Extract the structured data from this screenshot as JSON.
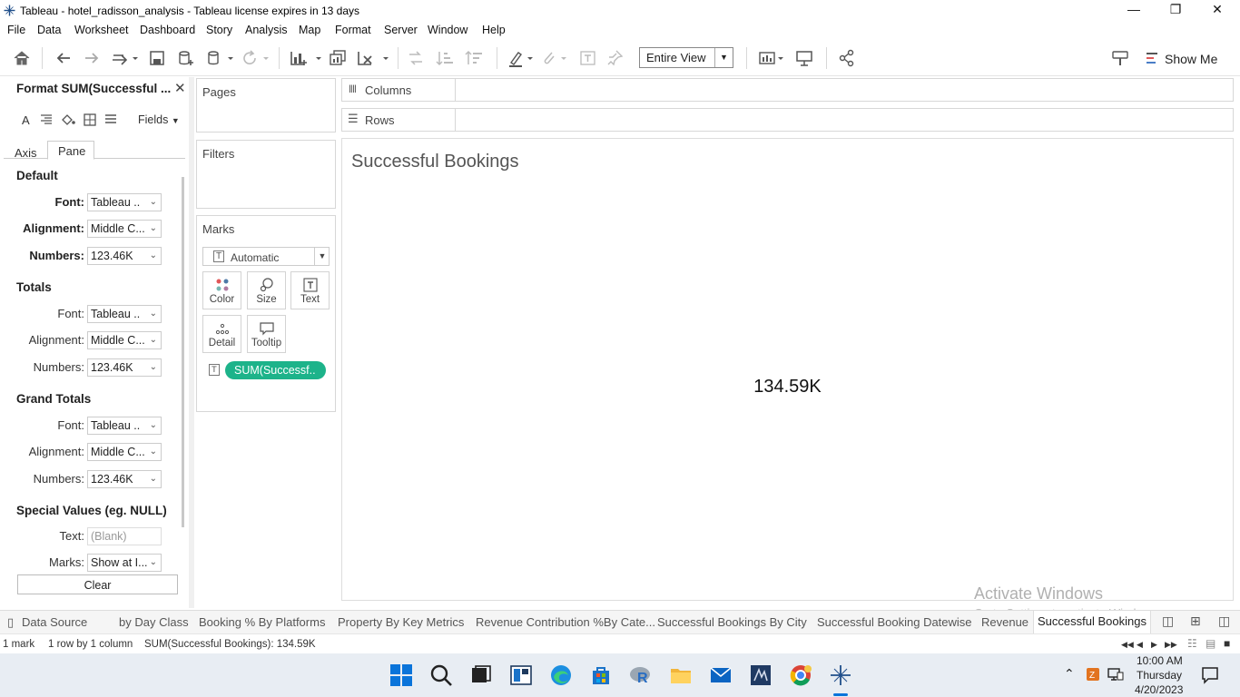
{
  "window": {
    "title": "Tableau - hotel_radisson_analysis - Tableau license expires in 13 days",
    "minimize": "—",
    "restore": "❐",
    "close": "✕"
  },
  "menu": [
    "File",
    "Data",
    "Worksheet",
    "Dashboard",
    "Story",
    "Analysis",
    "Map",
    "Format",
    "Server",
    "Window",
    "Help"
  ],
  "toolbar": {
    "fit_value": "Entire View",
    "show_me": "Show Me"
  },
  "format_pane": {
    "title": "Format SUM(Successful ...",
    "fields_label": "Fields",
    "tabs": [
      "Axis",
      "Pane"
    ],
    "active_tab": "Pane",
    "sections": {
      "default": {
        "heading": "Default",
        "font_label": "Font:",
        "font_value": "Tableau ..",
        "alignment_label": "Alignment:",
        "alignment_value": "Middle C...",
        "numbers_label": "Numbers:",
        "numbers_value": "123.46K"
      },
      "totals": {
        "heading": "Totals",
        "font_label": "Font:",
        "font_value": "Tableau ..",
        "alignment_label": "Alignment:",
        "alignment_value": "Middle C...",
        "numbers_label": "Numbers:",
        "numbers_value": "123.46K"
      },
      "grand_totals": {
        "heading": "Grand Totals",
        "font_label": "Font:",
        "font_value": "Tableau ..",
        "alignment_label": "Alignment:",
        "alignment_value": "Middle C...",
        "numbers_label": "Numbers:",
        "numbers_value": "123.46K"
      },
      "special": {
        "heading": "Special Values (eg. NULL)",
        "text_label": "Text:",
        "text_placeholder": "(Blank)",
        "marks_label": "Marks:",
        "marks_value": "Show at I..."
      }
    },
    "clear_button": "Clear"
  },
  "shelves": {
    "pages": "Pages",
    "filters": "Filters",
    "columns": "Columns",
    "rows": "Rows"
  },
  "marks": {
    "header": "Marks",
    "type": "Automatic",
    "buttons": [
      "Color",
      "Size",
      "Text",
      "Detail",
      "Tooltip"
    ],
    "pill": "SUM(Successf.."
  },
  "view": {
    "title": "Successful Bookings",
    "value": "134.59K"
  },
  "watermark": {
    "line1": "Activate Windows",
    "line2": "Go to Settings to activate Windows."
  },
  "sheet_tabs": [
    "Data Source",
    "by Day Class",
    "Booking % By Platforms",
    "Property By Key Metrics",
    "Revenue Contribution %By Cate...",
    "Successful Bookings By City",
    "Successful Booking Datewise",
    "Revenue",
    "Successful Bookings"
  ],
  "active_sheet": "Successful Bookings",
  "status": {
    "marks": "1 mark",
    "dims": "1 row by 1 column",
    "sum": "SUM(Successful Bookings): 134.59K"
  },
  "taskbar": {
    "time": "10:00 AM",
    "day": "Thursday",
    "date": "4/20/2023"
  }
}
